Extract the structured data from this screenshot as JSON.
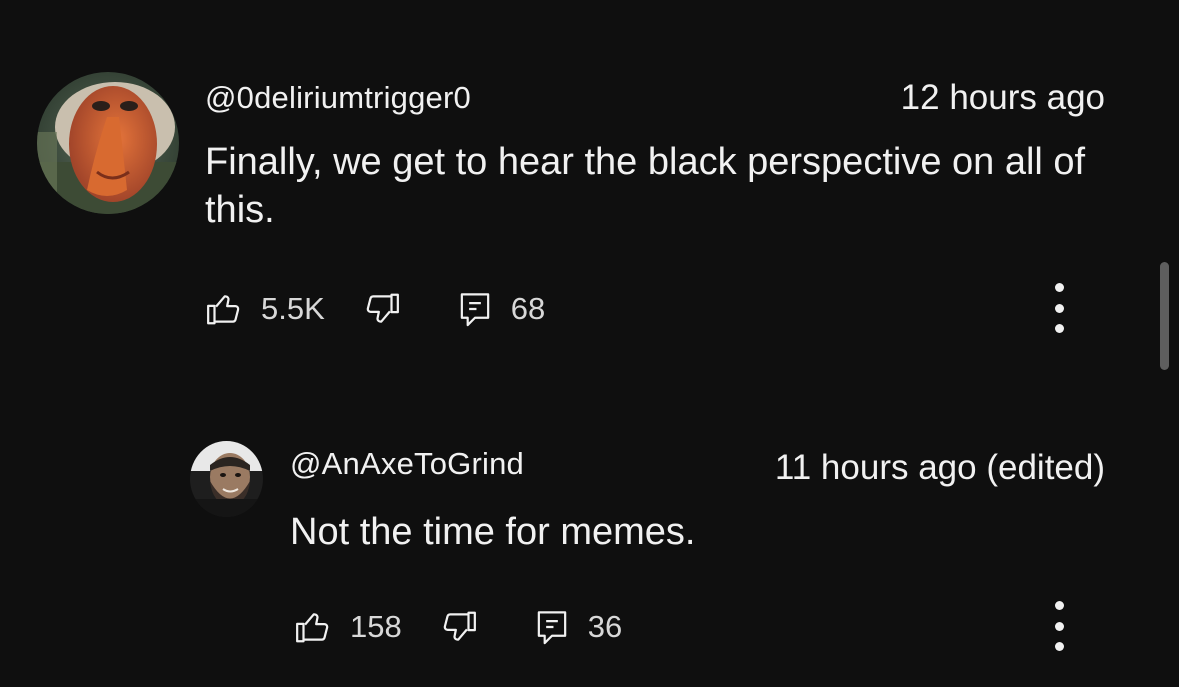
{
  "comments": [
    {
      "handle": "@0deliriumtrigger0",
      "time": "12 hours ago",
      "text": "Finally, we get to hear the black perspective on all of this.",
      "likes": "5.5K",
      "replies": "68",
      "avatar_icon": "proboscis-monkey-avatar"
    },
    {
      "handle": "@AnAxeToGrind",
      "time": "11 hours ago (edited)",
      "text": "Not the time for memes.",
      "likes": "158",
      "replies": "36",
      "avatar_icon": "bearded-man-avatar"
    }
  ],
  "icons": {
    "like": "thumbs-up-icon",
    "dislike": "thumbs-down-icon",
    "reply": "comment-icon",
    "more": "more-vertical-icon"
  },
  "colors": {
    "background": "#0f0f0f",
    "text": "#f1f1f1",
    "muted": "#d8d8d8",
    "scrollbar": "#5e5e5e"
  }
}
